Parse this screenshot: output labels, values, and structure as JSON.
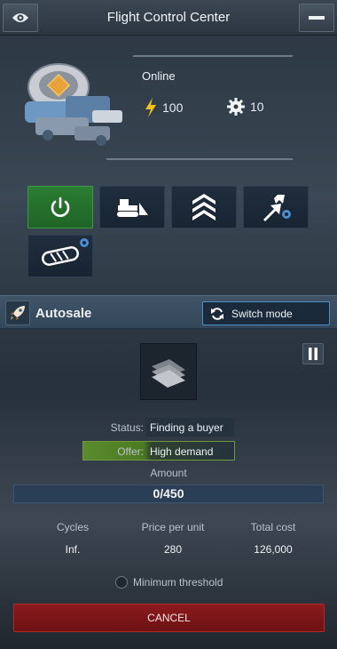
{
  "window": {
    "title": "Flight Control Center"
  },
  "ship": {
    "status": "Online",
    "energy": "100",
    "parts": "10"
  },
  "autosale": {
    "title": "Autosale",
    "switch_label": "Switch mode",
    "status_label": "Status:",
    "status_value": "Finding a buyer",
    "offer_label": "Offer:",
    "offer_value": "High demand",
    "amount_label": "Amount",
    "amount_value": "0/450",
    "amount_fraction": 0,
    "columns": [
      {
        "header": "Cycles",
        "value": "Inf."
      },
      {
        "header": "Price per unit",
        "value": "280"
      },
      {
        "header": "Total cost",
        "value": "126,000"
      }
    ],
    "threshold_label": "Minimum threshold",
    "cancel_label": "CANCEL"
  },
  "colors": {
    "accent_green": "#2b7d33",
    "cancel_red": "#8a1a1c",
    "switch_border": "#4e8ec3",
    "energy_yellow": "#f2c21b"
  },
  "icons": [
    "eye-icon",
    "minimize-icon",
    "lightning-icon",
    "gear-icon",
    "power-icon",
    "bulldozer-icon",
    "chevron-rank-icon",
    "transfer-arrows-icon",
    "conveyor-icon",
    "rocket-icon",
    "refresh-icon",
    "pause-icon",
    "resource-stack-icon"
  ]
}
